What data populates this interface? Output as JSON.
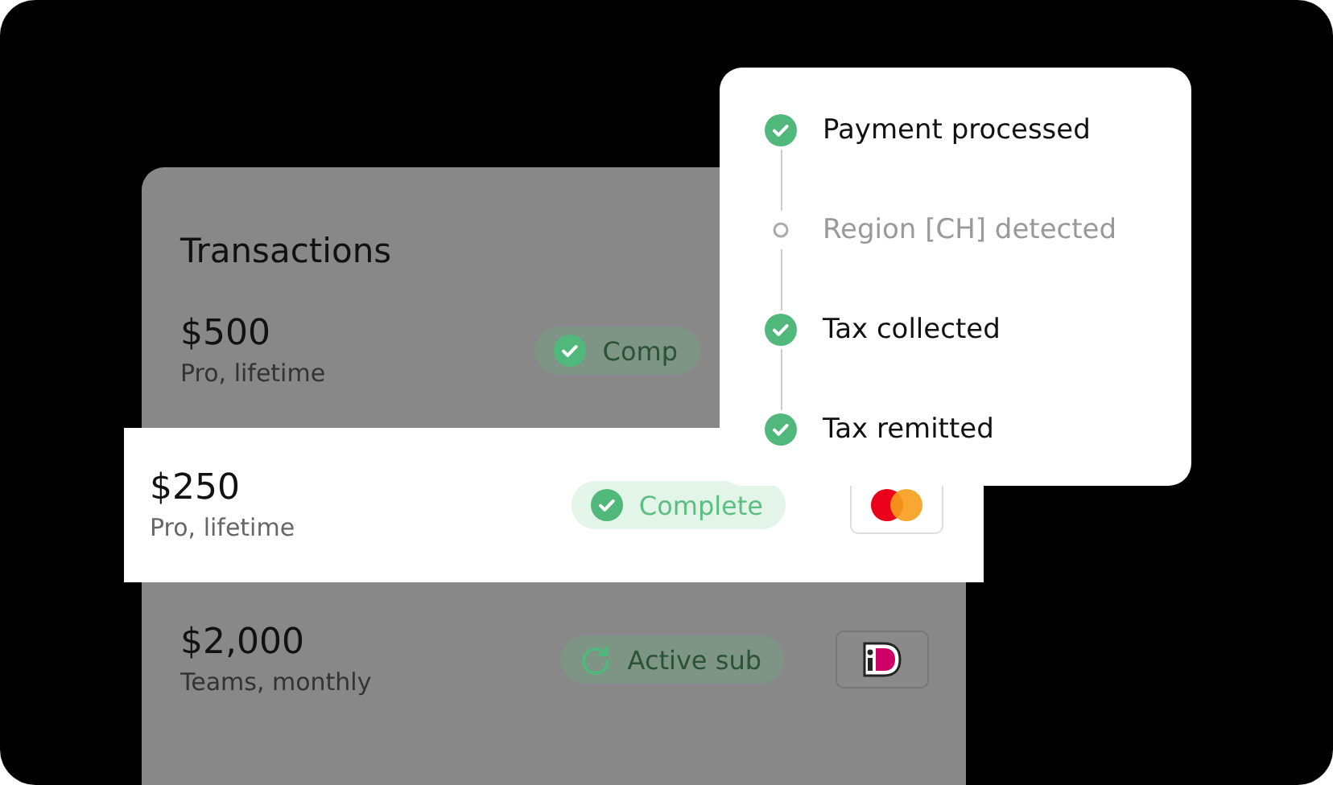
{
  "transactions": {
    "title": "Transactions",
    "rows": [
      {
        "amount": "$500",
        "plan": "Pro, lifetime",
        "highlighted": false,
        "status": {
          "kind": "complete",
          "label": "Comp"
        }
      },
      {
        "amount": "$250",
        "plan": "Pro, lifetime",
        "highlighted": true,
        "status": {
          "kind": "complete",
          "label": "Complete"
        },
        "payment": {
          "kind": "mastercard"
        }
      },
      {
        "amount": "$2,000",
        "plan": "Teams, monthly",
        "highlighted": false,
        "status": {
          "kind": "recurring",
          "label": "Active sub"
        },
        "payment": {
          "kind": "ideal"
        }
      }
    ]
  },
  "timeline": {
    "steps": [
      {
        "label": "Payment processed",
        "done": true
      },
      {
        "label": "Region [CH] detected",
        "done": false
      },
      {
        "label": "Tax collected",
        "done": true
      },
      {
        "label": "Tax remitted",
        "done": true
      }
    ]
  }
}
